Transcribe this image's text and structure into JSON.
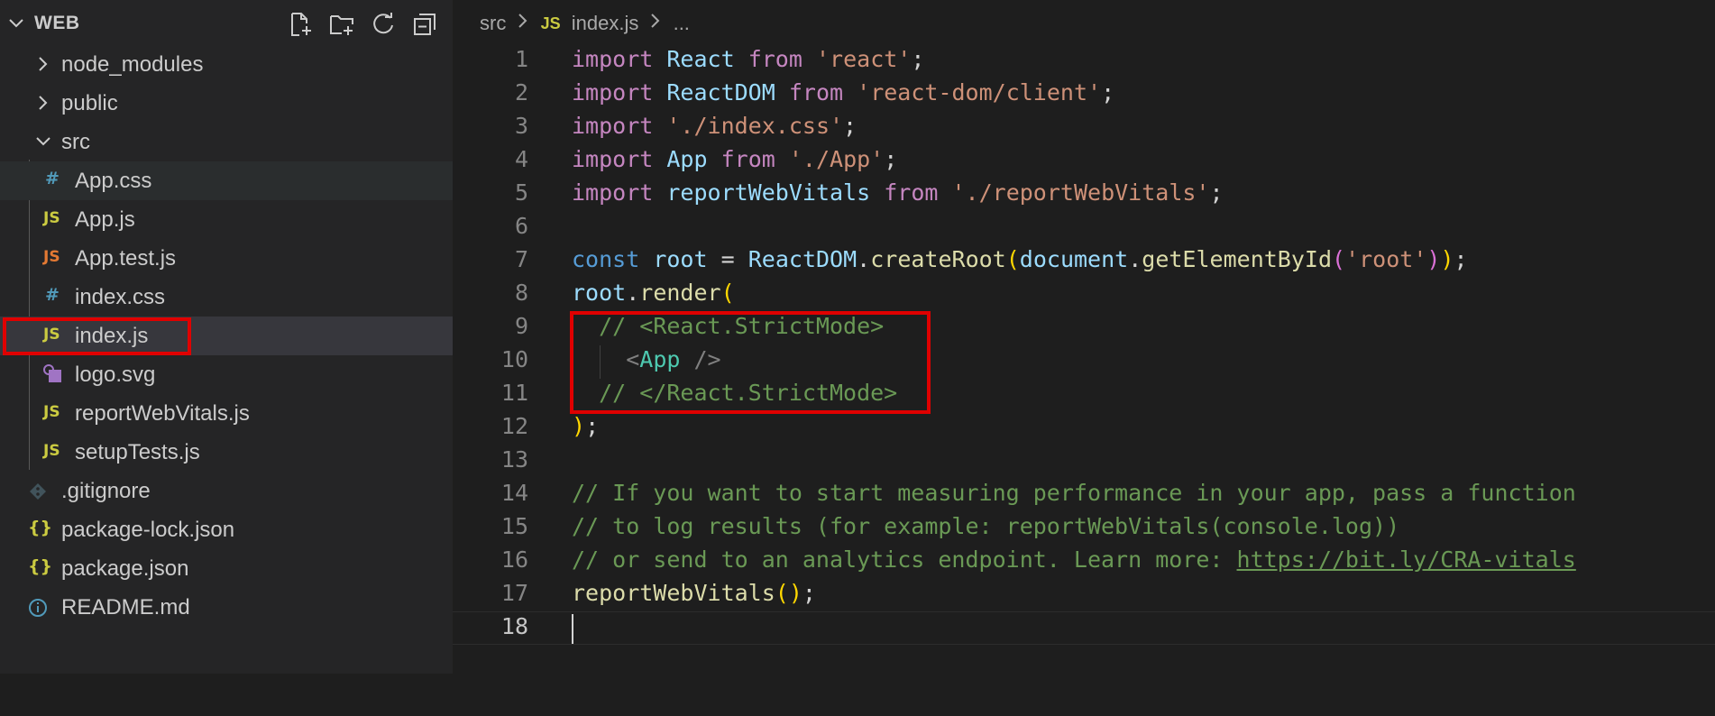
{
  "explorer": {
    "title": "WEB",
    "actions": [
      "new-file",
      "new-folder",
      "refresh",
      "collapse-all"
    ],
    "items": [
      {
        "label": "node_modules",
        "type": "folder",
        "expanded": false
      },
      {
        "label": "public",
        "type": "folder",
        "expanded": false
      },
      {
        "label": "src",
        "type": "folder",
        "expanded": true
      },
      {
        "label": "App.css",
        "type": "css",
        "icon": "#"
      },
      {
        "label": "App.js",
        "type": "js",
        "icon": "JS"
      },
      {
        "label": "App.test.js",
        "type": "js-test",
        "icon": "JS"
      },
      {
        "label": "index.css",
        "type": "css",
        "icon": "#"
      },
      {
        "label": "index.js",
        "type": "js",
        "icon": "JS",
        "selected": true
      },
      {
        "label": "logo.svg",
        "type": "svg"
      },
      {
        "label": "reportWebVitals.js",
        "type": "js",
        "icon": "JS"
      },
      {
        "label": "setupTests.js",
        "type": "js",
        "icon": "JS"
      },
      {
        "label": ".gitignore",
        "type": "git"
      },
      {
        "label": "package-lock.json",
        "type": "json",
        "icon": "{}"
      },
      {
        "label": "package.json",
        "type": "json",
        "icon": "{}"
      },
      {
        "label": "README.md",
        "type": "info"
      }
    ]
  },
  "breadcrumb": {
    "folder": "src",
    "file_icon": "JS",
    "file": "index.js",
    "more": "..."
  },
  "editor": {
    "current_line": 18,
    "lines": [
      {
        "n": "1",
        "text": "import React from 'react';"
      },
      {
        "n": "2",
        "text": "import ReactDOM from 'react-dom/client';"
      },
      {
        "n": "3",
        "text": "import './index.css';"
      },
      {
        "n": "4",
        "text": "import App from './App';"
      },
      {
        "n": "5",
        "text": "import reportWebVitals from './reportWebVitals';"
      },
      {
        "n": "6",
        "text": ""
      },
      {
        "n": "7",
        "text": "const root = ReactDOM.createRoot(document.getElementById('root'));"
      },
      {
        "n": "8",
        "text": "root.render("
      },
      {
        "n": "9",
        "text": "  // <React.StrictMode>"
      },
      {
        "n": "10",
        "text": "    <App />"
      },
      {
        "n": "11",
        "text": "  // </React.StrictMode>"
      },
      {
        "n": "12",
        "text": ");"
      },
      {
        "n": "13",
        "text": ""
      },
      {
        "n": "14",
        "text": "// If you want to start measuring performance in your app, pass a function"
      },
      {
        "n": "15",
        "text": "// to log results (for example: reportWebVitals(console.log))"
      },
      {
        "n": "16",
        "text": "// or send to an analytics endpoint. Learn more: https://bit.ly/CRA-vitals"
      },
      {
        "n": "17",
        "text": "reportWebVitals();"
      },
      {
        "n": "18",
        "text": ""
      }
    ],
    "tokens": {
      "l1": [
        "import",
        "React",
        "from",
        "'react'",
        ";"
      ],
      "l2": [
        "import",
        "ReactDOM",
        "from",
        "'react-dom/client'",
        ";"
      ],
      "l3": [
        "import",
        "'./index.css'",
        ";"
      ],
      "l4": [
        "import",
        "App",
        "from",
        "'./App'",
        ";"
      ],
      "l5": [
        "import",
        "reportWebVitals",
        "from",
        "'./reportWebVitals'",
        ";"
      ],
      "l7": [
        "const",
        "root",
        "=",
        "ReactDOM",
        ".",
        "createRoot",
        "(",
        "document",
        ".",
        "getElementById",
        "(",
        "'root'",
        ")",
        ")",
        ";"
      ],
      "l8": [
        "root",
        ".",
        "render",
        "("
      ],
      "l9": [
        "// <React.StrictMode>"
      ],
      "l10": [
        "<",
        "App",
        "/>"
      ],
      "l11": [
        "// </React.StrictMode>"
      ],
      "l12": [
        ")",
        ";"
      ],
      "l14": [
        "// If you want to start measuring performance in your app, pass a function"
      ],
      "l15": [
        "// to log results (for example: reportWebVitals(console.log))"
      ],
      "l16": [
        "// or send to an analytics endpoint. Learn more: ",
        "https://bit.ly/CRA-vitals"
      ],
      "l17": [
        "reportWebVitals",
        "(",
        ")",
        ";"
      ]
    }
  },
  "colors": {
    "annotation_red": "#e00000",
    "sidebar_bg": "#252526",
    "editor_bg": "#1e1e1e",
    "selected_row_bg": "#37373d"
  }
}
